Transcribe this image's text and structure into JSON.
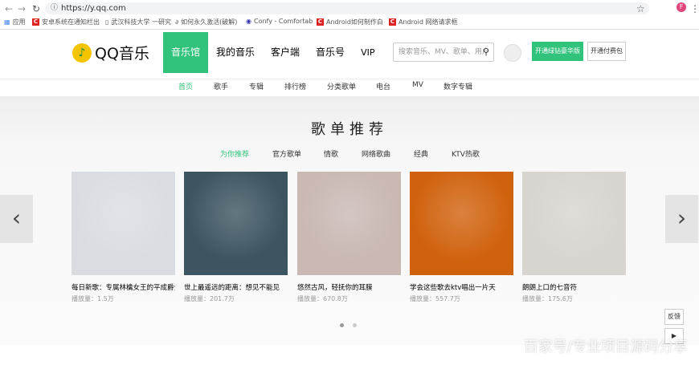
{
  "browser": {
    "url": "https://y.qq.com",
    "bookmarks": [
      "应用",
      "安卓系统在通知栏出",
      "武汉科技大学 一研究",
      "如何永久激活(破解)",
      "Confy - Comfortab",
      "Android如何制作白",
      "Android 网络请求框"
    ]
  },
  "header": {
    "logo": "QQ音乐",
    "nav": [
      "音乐馆",
      "我的音乐",
      "客户端",
      "音乐号",
      "VIP"
    ],
    "search_placeholder": "搜索音乐、MV、歌单、用户",
    "btn_green": "开通绿钻豪华版",
    "btn_pay": "开通付费包"
  },
  "subnav": [
    "首页",
    "歌手",
    "专辑",
    "排行榜",
    "分类歌单",
    "电台",
    "MV",
    "数字专辑"
  ],
  "section": {
    "title": "歌单推荐",
    "tabs": [
      "为你推荐",
      "官方歌单",
      "情歌",
      "网络歌曲",
      "经典",
      "KTV热歌"
    ],
    "cards": [
      {
        "title": "每日新歌：专属林檎女王的平成爵士",
        "plays": "播放量：1.5万",
        "color": "#d9dde2"
      },
      {
        "title": "世上最遥远的距离：想见不能见",
        "plays": "播放量：201.7万",
        "color": "#3d5560"
      },
      {
        "title": "悠然古风，轻抚你的耳膜",
        "plays": "播放量：670.8万",
        "color": "#c9b8b4"
      },
      {
        "title": "学会这些歌去ktv唱出一片天",
        "plays": "播放量：557.7万",
        "color": "#d0620e"
      },
      {
        "title": "朗朗上口的七音符",
        "plays": "播放量：175.6万",
        "color": "#d8d4cf"
      }
    ]
  },
  "side": {
    "feedback": "反馈"
  },
  "watermark": "百家号/专业项目源码分享"
}
